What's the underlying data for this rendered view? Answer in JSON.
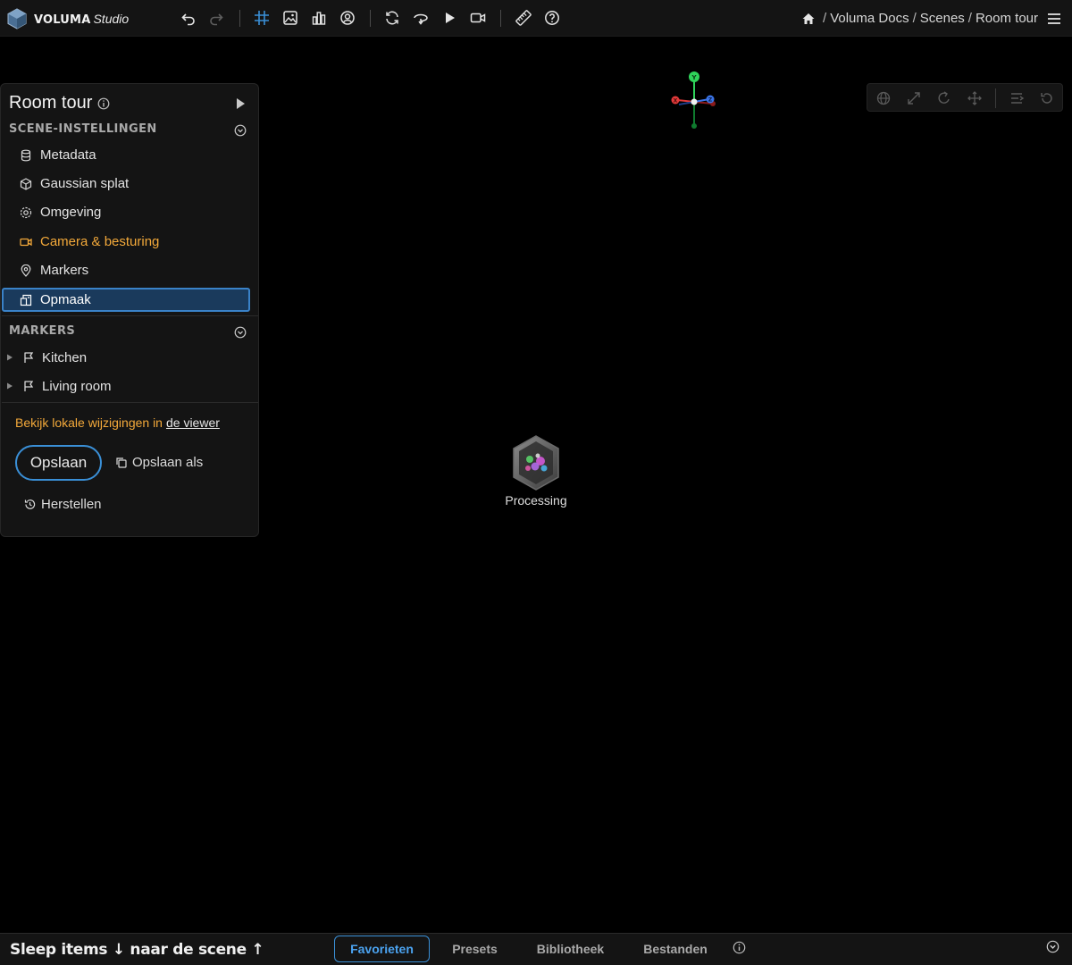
{
  "app": {
    "brand_name": "VOLUMA",
    "brand_suffix": "Studio",
    "accent_color": "#3a8fd6",
    "highlight_color": "#f3a93a"
  },
  "toolbar": {
    "icons": [
      "undo-icon",
      "redo-icon",
      "grid-icon",
      "image-icon",
      "chart-icon",
      "avatar-icon",
      "refresh-icon",
      "orbit-icon",
      "play-icon",
      "video-camera-icon",
      "ruler-icon",
      "help-icon"
    ]
  },
  "breadcrumb": {
    "items": [
      "Voluma Docs",
      "Scenes",
      "Room tour"
    ],
    "separator": "/"
  },
  "panel": {
    "title": "Room tour",
    "settings_header": "SCENE-INSTELLINGEN",
    "settings_items": [
      {
        "label": "Metadata",
        "icon": "database-icon"
      },
      {
        "label": "Gaussian splat",
        "icon": "cube-icon"
      },
      {
        "label": "Omgeving",
        "icon": "environment-icon"
      },
      {
        "label": "Camera & besturing",
        "icon": "camera-icon"
      },
      {
        "label": "Markers",
        "icon": "location-pin-icon"
      },
      {
        "label": "Opmaak",
        "icon": "layout-icon"
      }
    ],
    "markers_header": "MARKERS",
    "markers": [
      {
        "label": "Kitchen",
        "icon": "flag-icon"
      },
      {
        "label": "Living room",
        "icon": "flag-icon"
      }
    ],
    "notice_text": "Bekijk lokale wijzigingen in",
    "notice_link": "de viewer",
    "save_label": "Opslaan",
    "save_as_label": "Opslaan als",
    "restore_label": "Herstellen"
  },
  "gizmo": {
    "y_label": "Y",
    "x_label": "X",
    "z_label": "Z"
  },
  "viewbar": {
    "icons": [
      "globe-icon",
      "expand-icon",
      "rotate-icon",
      "move-icon",
      "align-icon",
      "reset-icon"
    ]
  },
  "status": {
    "label": "Processing"
  },
  "bottom": {
    "drag_hint": "Sleep items ↓ naar de scene ↑",
    "tabs": [
      "Favorieten",
      "Presets",
      "Bibliotheek",
      "Bestanden"
    ],
    "active_tab": "Favorieten"
  }
}
